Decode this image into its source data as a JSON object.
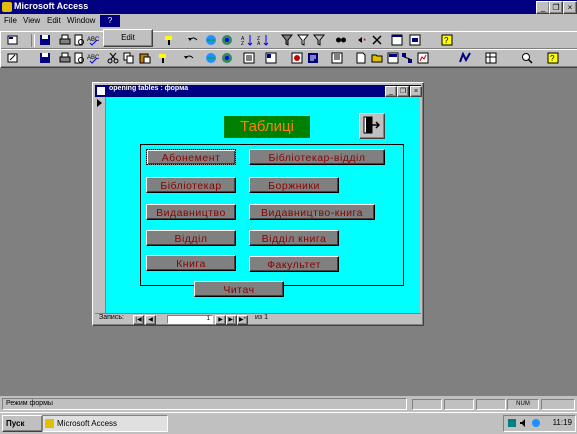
{
  "app": {
    "title": "Microsoft Access"
  },
  "window_buttons": {
    "minimize": "_",
    "restore": "❐",
    "close": "×"
  },
  "menu": {
    "items": [
      "File",
      "View",
      "Edit",
      "Window",
      "?"
    ],
    "dropdown_label": "Edit"
  },
  "form": {
    "title": "opening tables : форма",
    "heading": "Таблиці",
    "buttons": [
      "Абонемент",
      "Бібліотекар-відділ",
      "Бібліотекар",
      "Боржники",
      "Видавництво",
      "Видавництво-книга",
      "Відділ",
      "Відділ книга",
      "Книга",
      "Факультет",
      "Читач"
    ],
    "record_nav": {
      "label": "Запись:",
      "current": "1",
      "count": "из 1"
    }
  },
  "status": {
    "text": "Режим формы",
    "num": "NUM"
  },
  "taskbar": {
    "start_label": "Пуск",
    "task_label": "Microsoft Access",
    "clock": "11:19"
  }
}
